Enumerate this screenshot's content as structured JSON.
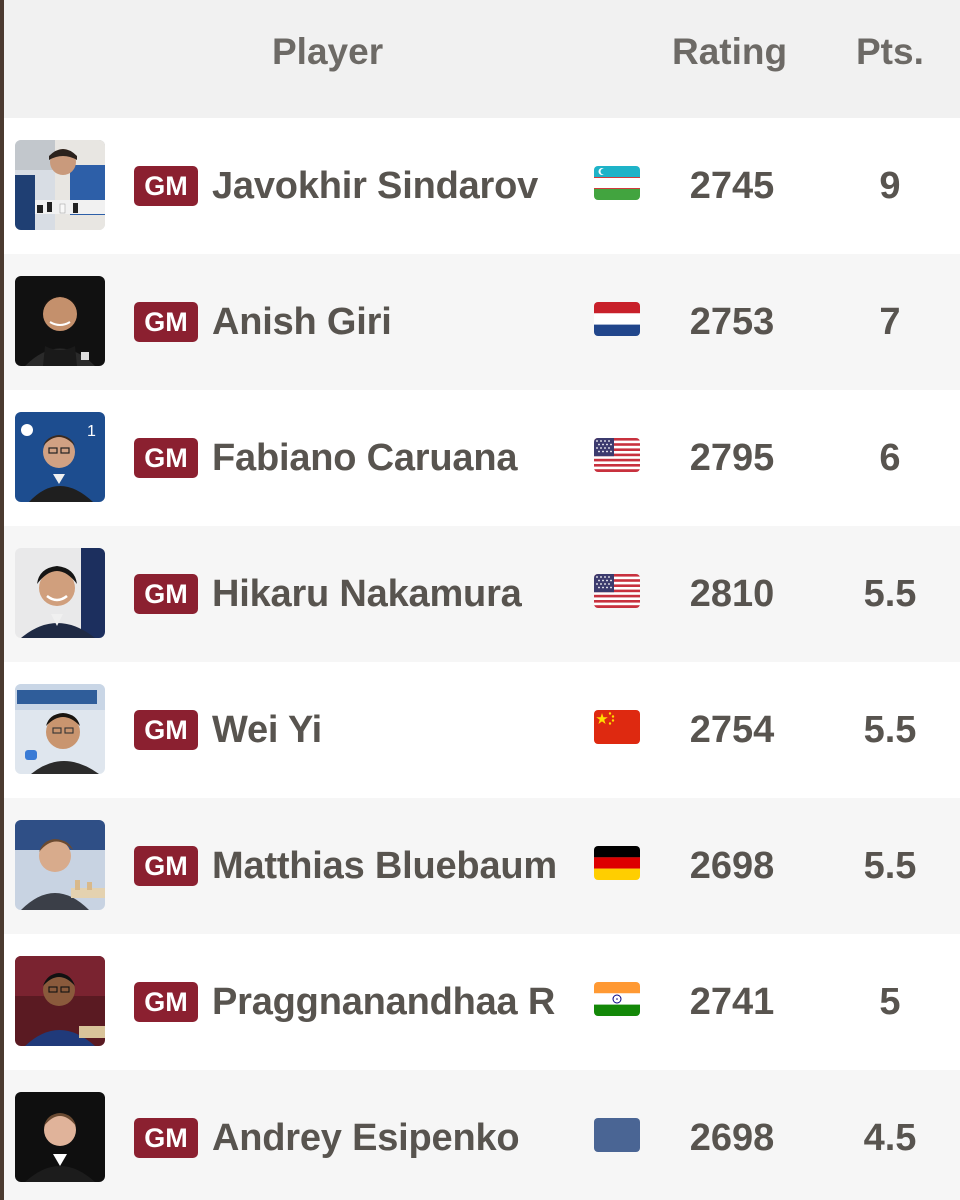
{
  "header": {
    "player_label": "Player",
    "rating_label": "Rating",
    "points_label": "Pts."
  },
  "colors": {
    "title_badge": "#8b2030",
    "header_bg": "#f1f1f1",
    "text": "#58544f"
  },
  "players": [
    {
      "title": "GM",
      "name": "Javokhir Sindarov",
      "flag": "uzbekistan-flag",
      "rating": "2745",
      "points": "9"
    },
    {
      "title": "GM",
      "name": "Anish Giri",
      "flag": "netherlands-flag",
      "rating": "2753",
      "points": "7"
    },
    {
      "title": "GM",
      "name": "Fabiano Caruana",
      "flag": "usa-flag",
      "rating": "2795",
      "points": "6"
    },
    {
      "title": "GM",
      "name": "Hikaru Nakamura",
      "flag": "usa-flag",
      "rating": "2810",
      "points": "5.5"
    },
    {
      "title": "GM",
      "name": "Wei Yi",
      "flag": "china-flag",
      "rating": "2754",
      "points": "5.5"
    },
    {
      "title": "GM",
      "name": "Matthias Bluebaum",
      "flag": "germany-flag",
      "rating": "2698",
      "points": "5.5"
    },
    {
      "title": "GM",
      "name": "Praggnanandhaa R",
      "flag": "india-flag",
      "rating": "2741",
      "points": "5"
    },
    {
      "title": "GM",
      "name": "Andrey Esipenko",
      "flag": "fide-flag",
      "rating": "2698",
      "points": "4.5"
    }
  ]
}
